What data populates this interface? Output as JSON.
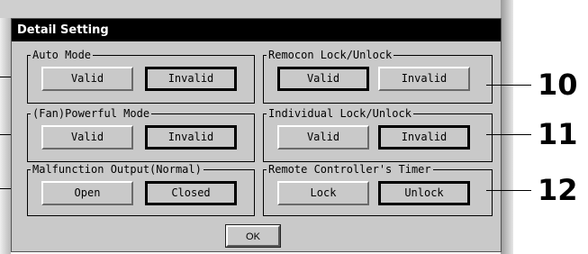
{
  "dialog": {
    "title": "Detail Setting",
    "ok_label": "OK"
  },
  "groups": {
    "auto_mode": {
      "label": "Auto Mode",
      "options": [
        "Valid",
        "Invalid"
      ],
      "selected": "Invalid"
    },
    "fan_powerful_mode": {
      "label": "(Fan)Powerful Mode",
      "options": [
        "Valid",
        "Invalid"
      ],
      "selected": "Invalid"
    },
    "malfunction_output": {
      "label": "Malfunction Output(Normal)",
      "options": [
        "Open",
        "Closed"
      ],
      "selected": "Closed"
    },
    "remocon_lock": {
      "label": "Remocon Lock/Unlock",
      "options": [
        "Valid",
        "Invalid"
      ],
      "selected": "Valid"
    },
    "individual_lock": {
      "label": "Individual Lock/Unlock",
      "options": [
        "Valid",
        "Invalid"
      ],
      "selected": "Invalid"
    },
    "remote_timer": {
      "label": "Remote Controller's Timer",
      "options": [
        "Lock",
        "Unlock"
      ],
      "selected": "Unlock"
    }
  },
  "callouts": [
    "10",
    "11",
    "12"
  ],
  "colors": {
    "titlebar": "#000000",
    "dialog_bg": "#c9c9c9",
    "text": "#000000"
  }
}
